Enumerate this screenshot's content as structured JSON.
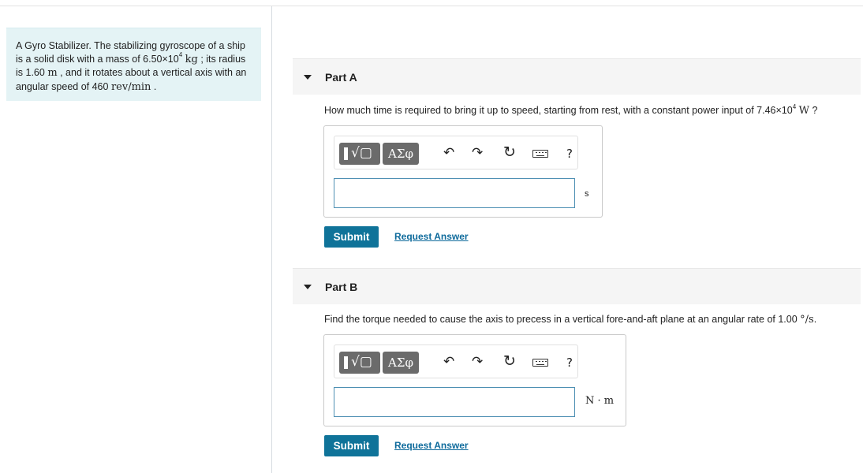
{
  "problem": {
    "prefix": "A Gyro Stabilizer. The stabilizing gyroscope of a ship is a solid disk with a mass of 6.50×10",
    "mass_exp": "4",
    "mass_unit": "kg",
    "mid1": " ; its radius is 1.60 ",
    "radius_unit": "m",
    "mid2": " , and it rotates about a vertical axis with an angular speed of 460 ",
    "speed_unit": "rev/min",
    "suffix": " ."
  },
  "parts": [
    {
      "title": "Part A",
      "question_prefix": "How much time is required to bring it up to speed, starting from rest, with a constant power input of 7.46×10",
      "question_exp": "4",
      "question_unit": "W",
      "question_suffix": " ?",
      "answer_value": "",
      "unit": "s",
      "submit_label": "Submit",
      "request_label": "Request Answer"
    },
    {
      "title": "Part B",
      "question_prefix": "Find the torque needed to cause the axis to precess in a vertical fore-and-aft plane at an angular rate of 1.00 ",
      "question_unit": "°/s",
      "question_suffix": ".",
      "answer_value": "",
      "unit": "N · m",
      "submit_label": "Submit",
      "request_label": "Request Answer"
    }
  ],
  "toolbar": {
    "templates_label": "√▢",
    "symbols_label": "ΑΣφ",
    "undo_icon": "↶",
    "redo_icon": "↷",
    "reset_icon": "↻",
    "keyboard_icon": "keyboard-icon",
    "help_label": "?"
  },
  "colors": {
    "problem_bg": "#e4f3f5",
    "submit_bg": "#0f7399",
    "link": "#0f6b9c",
    "toolbar_button": "#6b6b6b"
  }
}
